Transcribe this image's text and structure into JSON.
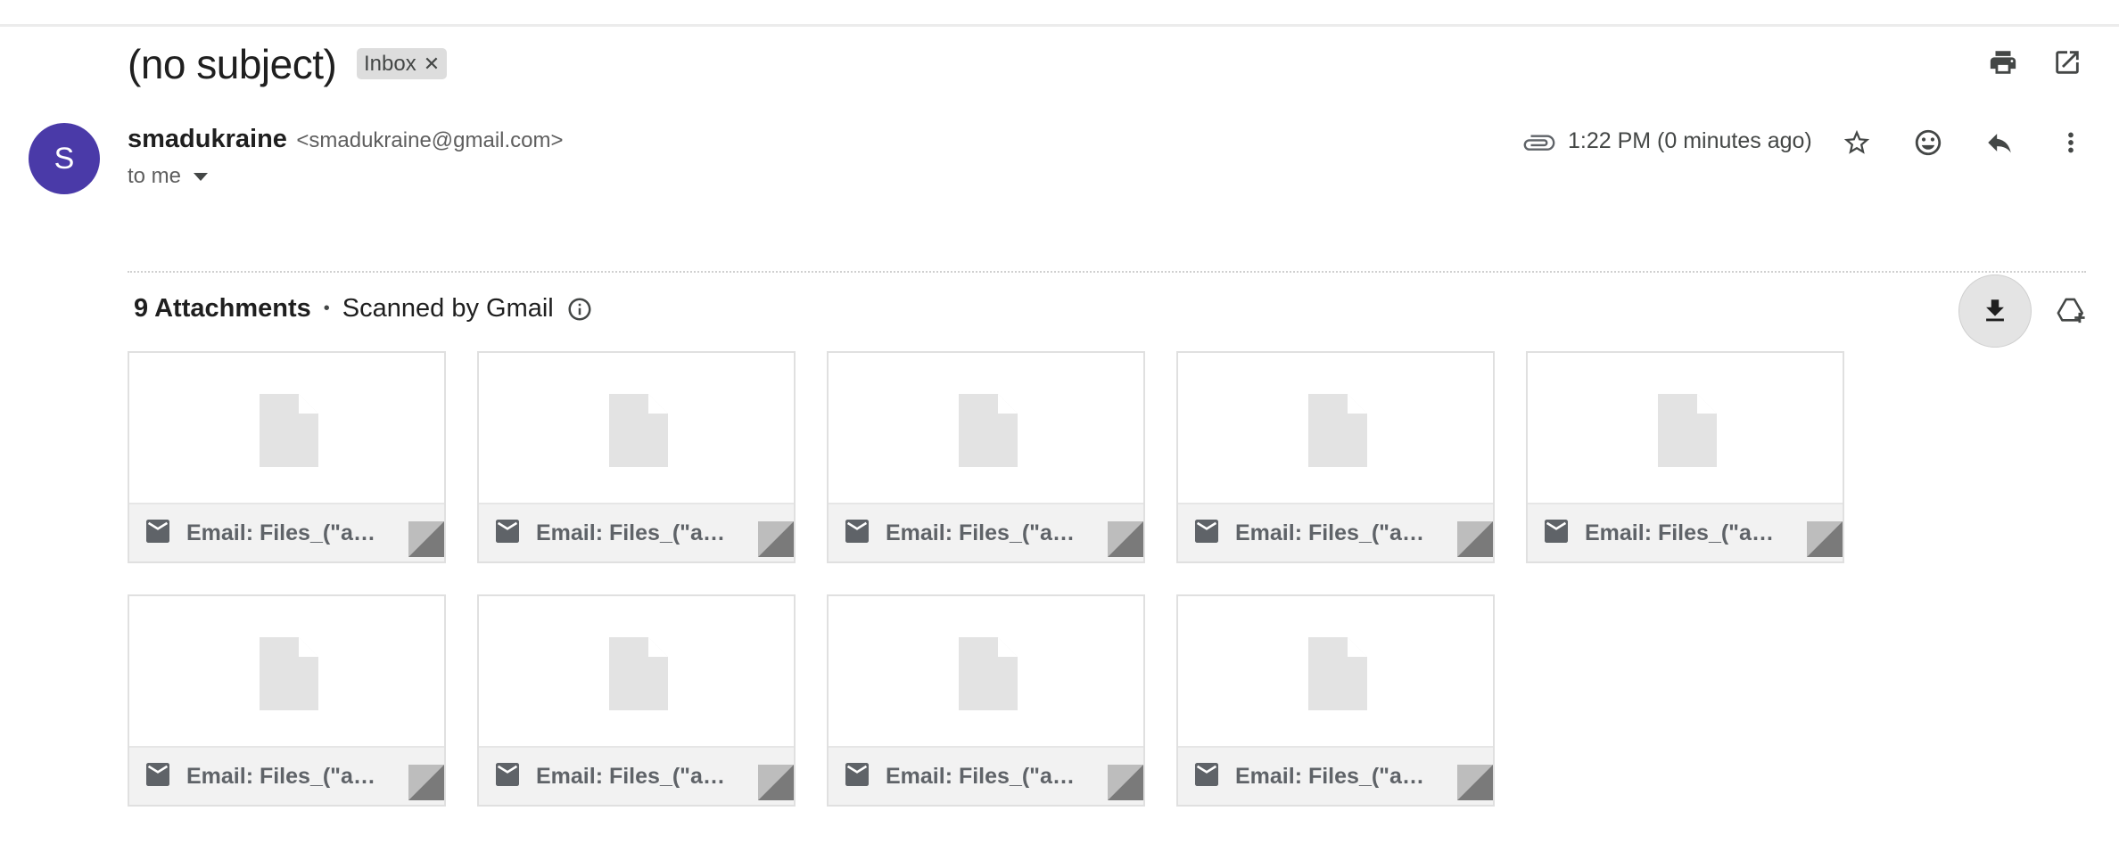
{
  "email": {
    "subject": "(no subject)",
    "label": "Inbox",
    "sender": {
      "avatar_letter": "S",
      "avatar_color": "#4a3aa8",
      "name": "smadukraine",
      "email": "<smadukraine@gmail.com>"
    },
    "recipient_text": "to me",
    "timestamp": "1:22 PM (0 minutes ago)"
  },
  "attachments": {
    "count_label": "9 Attachments",
    "separator": "•",
    "scanned_label": "Scanned by Gmail",
    "items": [
      {
        "name": "Email: Files_(\"ab..."
      },
      {
        "name": "Email: Files_(\"ab..."
      },
      {
        "name": "Email: Files_(\"ab..."
      },
      {
        "name": "Email: Files_(\"ab..."
      },
      {
        "name": "Email: Files_(\"ab..."
      },
      {
        "name": "Email: Files_(\"ab..."
      },
      {
        "name": "Email: Files_(\"ab..."
      },
      {
        "name": "Email: Files_(\"ab..."
      },
      {
        "name": "Email: Files_(\"ab..."
      }
    ]
  },
  "icons": {
    "header": [
      "print-icon",
      "open-in-new-window-icon"
    ],
    "message_actions": [
      "paperclip-icon",
      "star-icon",
      "emoji-icon",
      "reply-icon",
      "more-vert-icon"
    ],
    "attachment_actions": [
      "download-icon",
      "add-to-drive-icon"
    ],
    "attachment_card": [
      "document-icon",
      "mail-icon"
    ]
  }
}
